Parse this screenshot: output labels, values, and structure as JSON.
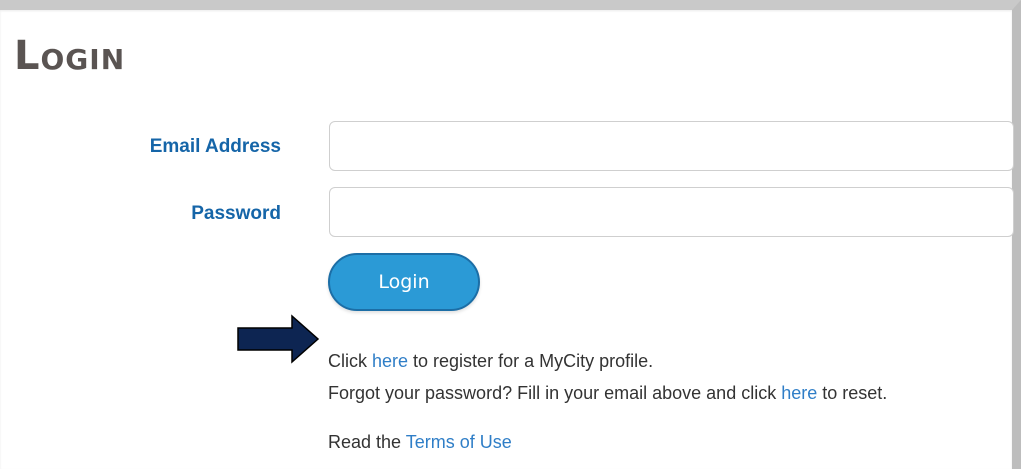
{
  "page": {
    "title": "Login"
  },
  "form": {
    "email_label": "Email Address",
    "email_value": "",
    "password_label": "Password",
    "password_value": "",
    "login_button": "Login"
  },
  "links": {
    "register_prefix": "Click ",
    "register_link": "here",
    "register_suffix": " to register for a MyCity profile.",
    "forgot_prefix": "Forgot your password? Fill in your email above and click ",
    "forgot_link": "here",
    "forgot_suffix": " to reset.",
    "terms_prefix": "Read the ",
    "terms_link": "Terms of Use"
  },
  "annotation": {
    "arrow_icon": "right-arrow-icon",
    "arrow_color": "#0d2552"
  },
  "colors": {
    "title": "#5a5452",
    "label": "#1565a8",
    "button": "#2b9ad6",
    "link": "#2f7ec7",
    "text": "#333333"
  }
}
